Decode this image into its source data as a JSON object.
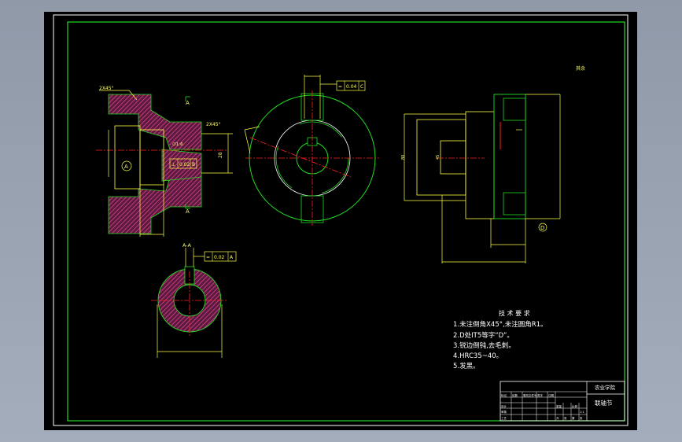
{
  "drawing": {
    "chamfer_top": "2X45°",
    "chamfer_right": "2X45°",
    "taper": "∅1:6",
    "diameter_dim": "28",
    "datum_a": "A",
    "datum_d": "D",
    "tol_left": [
      "⊥",
      "0.02",
      "B"
    ],
    "tol_top": [
      "=",
      "0.04",
      "C"
    ],
    "tol_section": [
      "=",
      "0.02",
      "A"
    ],
    "section_label": "A-A",
    "roughness_note": "其余",
    "side_dim_a": "80",
    "side_dim_b": "45"
  },
  "tech": {
    "title": "技 术 要 求",
    "items": [
      "1.未注倒角X45°,未注圆角R1。",
      "2.D处IT5等字“D”。",
      "3.锐边倒钝,去毛刺。",
      "4.HRC35~40。",
      "5.发黑。"
    ]
  },
  "titleblock": {
    "school": "农业学院",
    "part_name": "联轴节",
    "cells": [
      "标记",
      "处数",
      "更改文件号",
      "签字",
      "日期",
      "设计",
      "审核",
      "工艺",
      "重量",
      "比例",
      "共",
      "张",
      "第",
      "张",
      "1:1"
    ]
  },
  "colors": {
    "border": "#22dd22",
    "dims": "#ffff44",
    "center": "#ff2222",
    "hatch": "#d6338f",
    "text": "#ffffff"
  }
}
